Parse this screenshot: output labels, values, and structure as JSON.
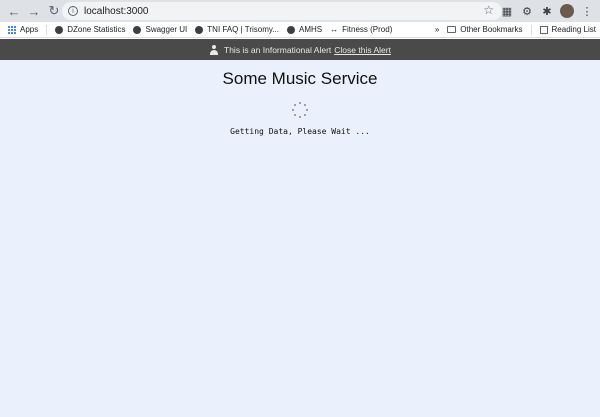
{
  "browser": {
    "url": "localhost:3000",
    "bookmarks": [
      "Apps",
      "DZone Statistics",
      "Swagger UI",
      "TNI FAQ | Trisomy...",
      "AMHS",
      "Fitness (Prod)"
    ],
    "more_label": "»",
    "other_bookmarks": "Other Bookmarks",
    "reading_list": "Reading List"
  },
  "alert": {
    "message": "This is an Informational Alert",
    "close_label": "Close this Alert"
  },
  "main": {
    "title": "Some Music Service",
    "loading_text": "Getting Data, Please Wait ..."
  },
  "colors": {
    "alert_bg": "#4a4a4a",
    "page_bg": "#eaf1fc",
    "toolbar_bg": "#dee1e6"
  }
}
